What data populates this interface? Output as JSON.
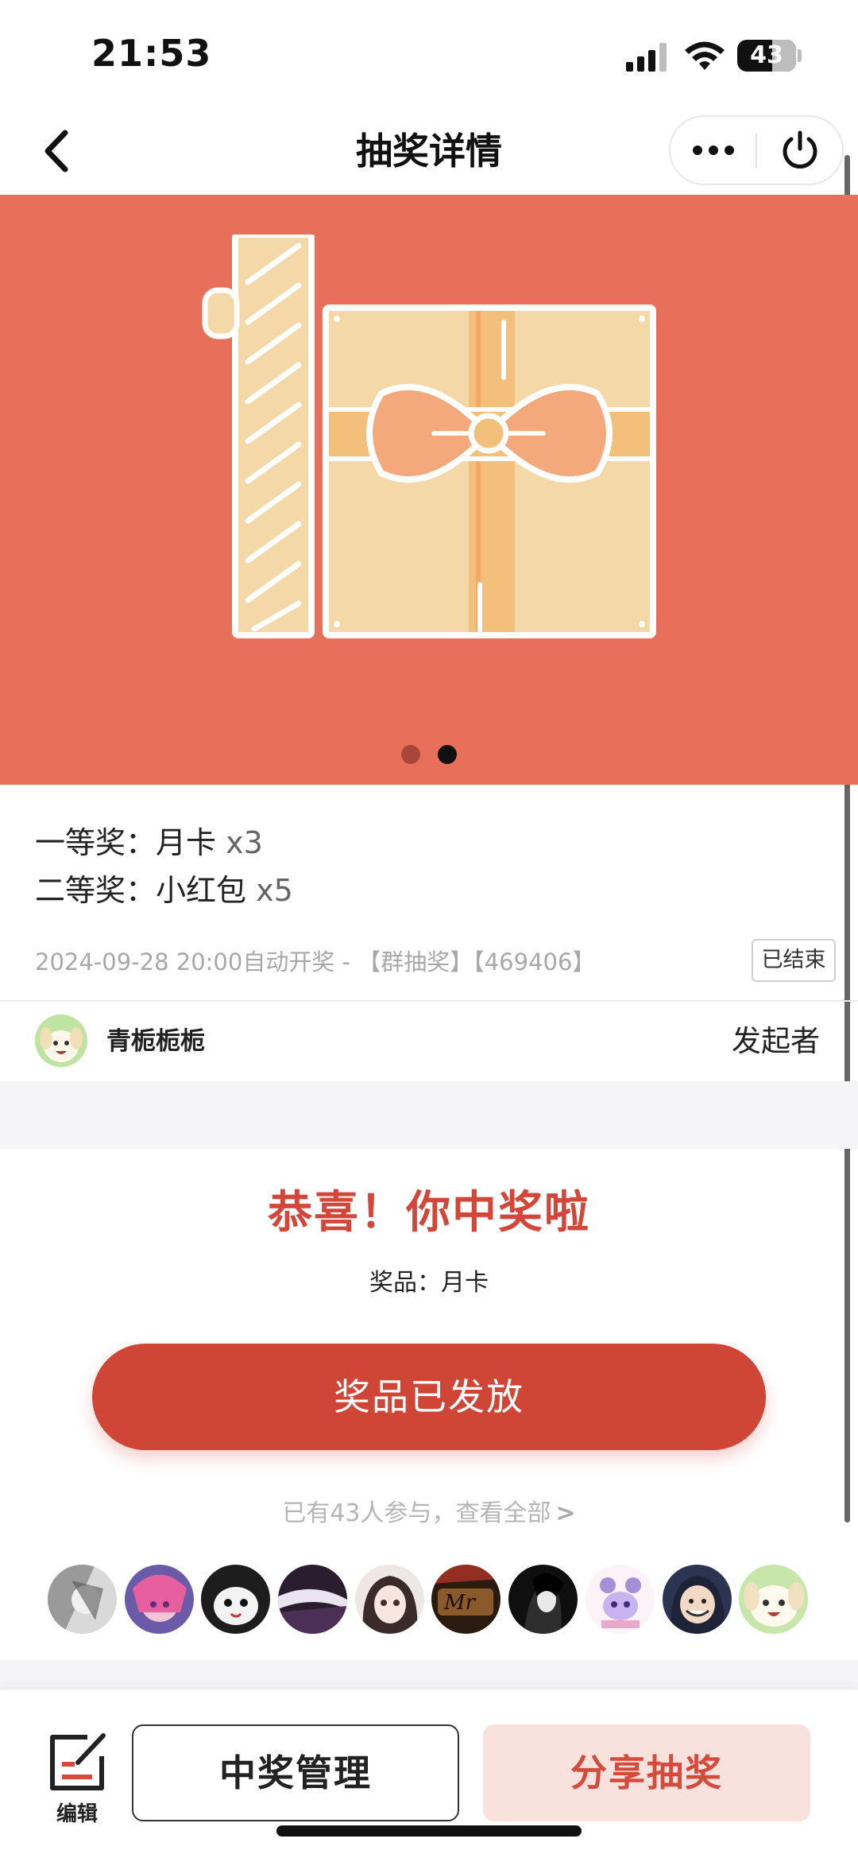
{
  "status_bar": {
    "time": "21:53",
    "battery": "43",
    "icons": [
      "signal-icon",
      "wifi-icon",
      "battery-icon"
    ]
  },
  "nav": {
    "title": "抽奖详情",
    "icons": [
      "back-icon",
      "more-icon",
      "power-icon"
    ]
  },
  "banner": {
    "image": "gift-box-illustration",
    "background_color": "#e86f59",
    "page_count": 2,
    "active_index": 1
  },
  "prizes": [
    {
      "tier": "一等奖：",
      "name": "月卡",
      "qty": " x3"
    },
    {
      "tier": "二等奖：",
      "name": "小红包",
      "qty": " x5"
    }
  ],
  "meta": {
    "info": "2024-09-28 20:00自动开奖 - 【群抽奖】【469406】",
    "status_tag": "已结束"
  },
  "initiator": {
    "name": "青栀栀栀",
    "role": "发起者"
  },
  "result": {
    "title": "恭喜！你中奖啦",
    "prize_text": "奖品：月卡",
    "button_label": "奖品已发放"
  },
  "participants": {
    "link_text": "已有43人参与，查看全部",
    "arrow": ">",
    "avatar_count": 10
  },
  "bottom_bar": {
    "edit_label": "编辑",
    "manage_label": "中奖管理",
    "share_label": "分享抽奖"
  },
  "colors": {
    "accent": "#cf4536",
    "banner": "#e86f59",
    "share_bg": "#f9e1de"
  }
}
